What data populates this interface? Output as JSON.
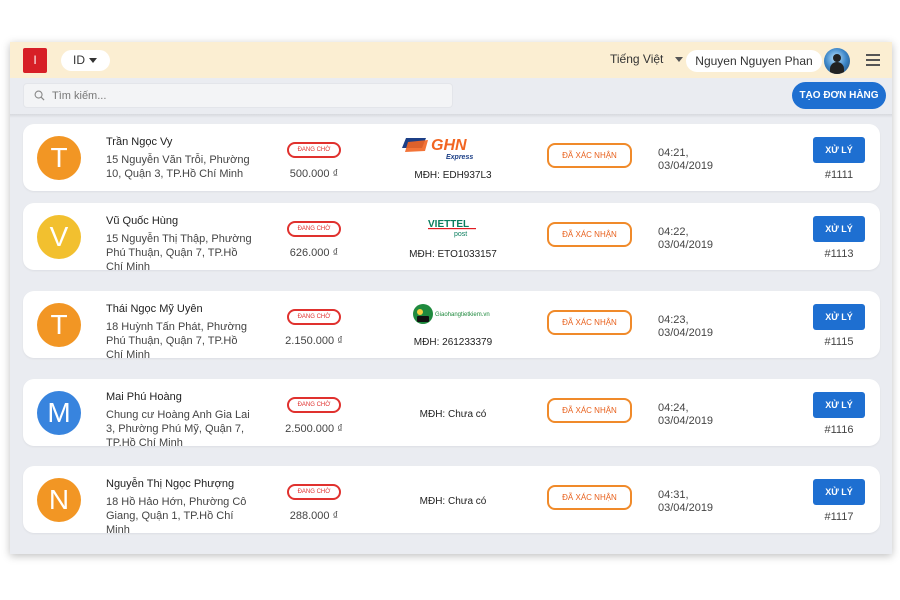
{
  "header": {
    "logo_text": "I",
    "lang_code": "ID",
    "ui_language": "Tiếng Việt",
    "user_name": "Nguyen Nguyen Phan"
  },
  "search": {
    "placeholder": "Tìm kiếm..."
  },
  "create_button": "TẠO ĐƠN HÀNG",
  "colors": {
    "accent": "#1e6fd1",
    "header_bg": "#fbeed2",
    "pending_red": "#e0312e",
    "confirmed_orange": "#f08a2a",
    "avatar_orange": "#f29624",
    "avatar_yellow": "#f2c02f",
    "avatar_blue": "#3884de"
  },
  "orders": [
    {
      "initial": "T",
      "avatar_color": "#f29624",
      "name": "Trần Ngọc Vy",
      "address": "15 Nguyễn Văn Trỗi, Phường 10, Quận 3, TP.Hồ Chí Minh",
      "status": "ĐANG CHỜ",
      "price": "500.000 ₫",
      "carrier_logo": "ghn-logo",
      "carrier_primary": "GHN",
      "carrier_sub": "Express",
      "order_code": "MĐH: EDH937L3",
      "confirm": "ĐÃ XÁC NHẬN",
      "time": "04:21,",
      "date": "03/04/2019",
      "action": "XỬ LÝ",
      "order_id": "#1111"
    },
    {
      "initial": "V",
      "avatar_color": "#f2c02f",
      "name": "Vũ Quốc Hùng",
      "address": "15 Nguyễn Thị Thập, Phường Phú Thuận, Quận 7, TP.Hồ Chí Minh",
      "status": "ĐANG CHỜ",
      "price": "626.000 ₫",
      "carrier_logo": "viettel-post-logo",
      "carrier_primary": "VIETTEL",
      "carrier_sub": "post",
      "order_code": "MĐH: ETO1033157",
      "confirm": "ĐÃ XÁC NHẬN",
      "time": "04:22,",
      "date": "03/04/2019",
      "action": "XỬ LÝ",
      "order_id": "#1113"
    },
    {
      "initial": "T",
      "avatar_color": "#f29624",
      "name": "Thái Ngọc Mỹ Uyên",
      "address": "18 Huỳnh Tấn Phát, Phường Phú Thuận, Quận 7, TP.Hồ Chí Minh",
      "status": "ĐANG CHỜ",
      "price": "2.150.000 ₫",
      "carrier_logo": "giao-hang-tiet-kiem-logo",
      "carrier_primary": "Giaohangtietkiem.vn",
      "carrier_sub": "",
      "order_code": "MĐH: 261233379",
      "confirm": "ĐÃ XÁC NHẬN",
      "time": "04:23,",
      "date": "03/04/2019",
      "action": "XỬ LÝ",
      "order_id": "#1115"
    },
    {
      "initial": "M",
      "avatar_color": "#3884de",
      "name": "Mai Phú Hoàng",
      "address": "Chung cư Hoàng Anh Gia Lai 3, Phường Phú Mỹ, Quận 7, TP.Hồ Chí Minh",
      "status": "ĐANG CHỜ",
      "price": "2.500.000 ₫",
      "carrier_logo": "",
      "carrier_primary": "",
      "carrier_sub": "",
      "order_code": "MĐH: Chưa có",
      "confirm": "ĐÃ XÁC NHẬN",
      "time": "04:24,",
      "date": "03/04/2019",
      "action": "XỬ LÝ",
      "order_id": "#1116"
    },
    {
      "initial": "N",
      "avatar_color": "#f29624",
      "name": "Nguyễn Thị Ngọc Phượng",
      "address": "18 Hồ Hảo Hớn, Phường Cô Giang, Quận 1, TP.Hồ Chí Minh",
      "status": "ĐANG CHỜ",
      "price": "288.000 ₫",
      "carrier_logo": "",
      "carrier_primary": "",
      "carrier_sub": "",
      "order_code": "MĐH: Chưa có",
      "confirm": "ĐÃ XÁC NHẬN",
      "time": "04:31,",
      "date": "03/04/2019",
      "action": "XỬ LÝ",
      "order_id": "#1117"
    }
  ]
}
